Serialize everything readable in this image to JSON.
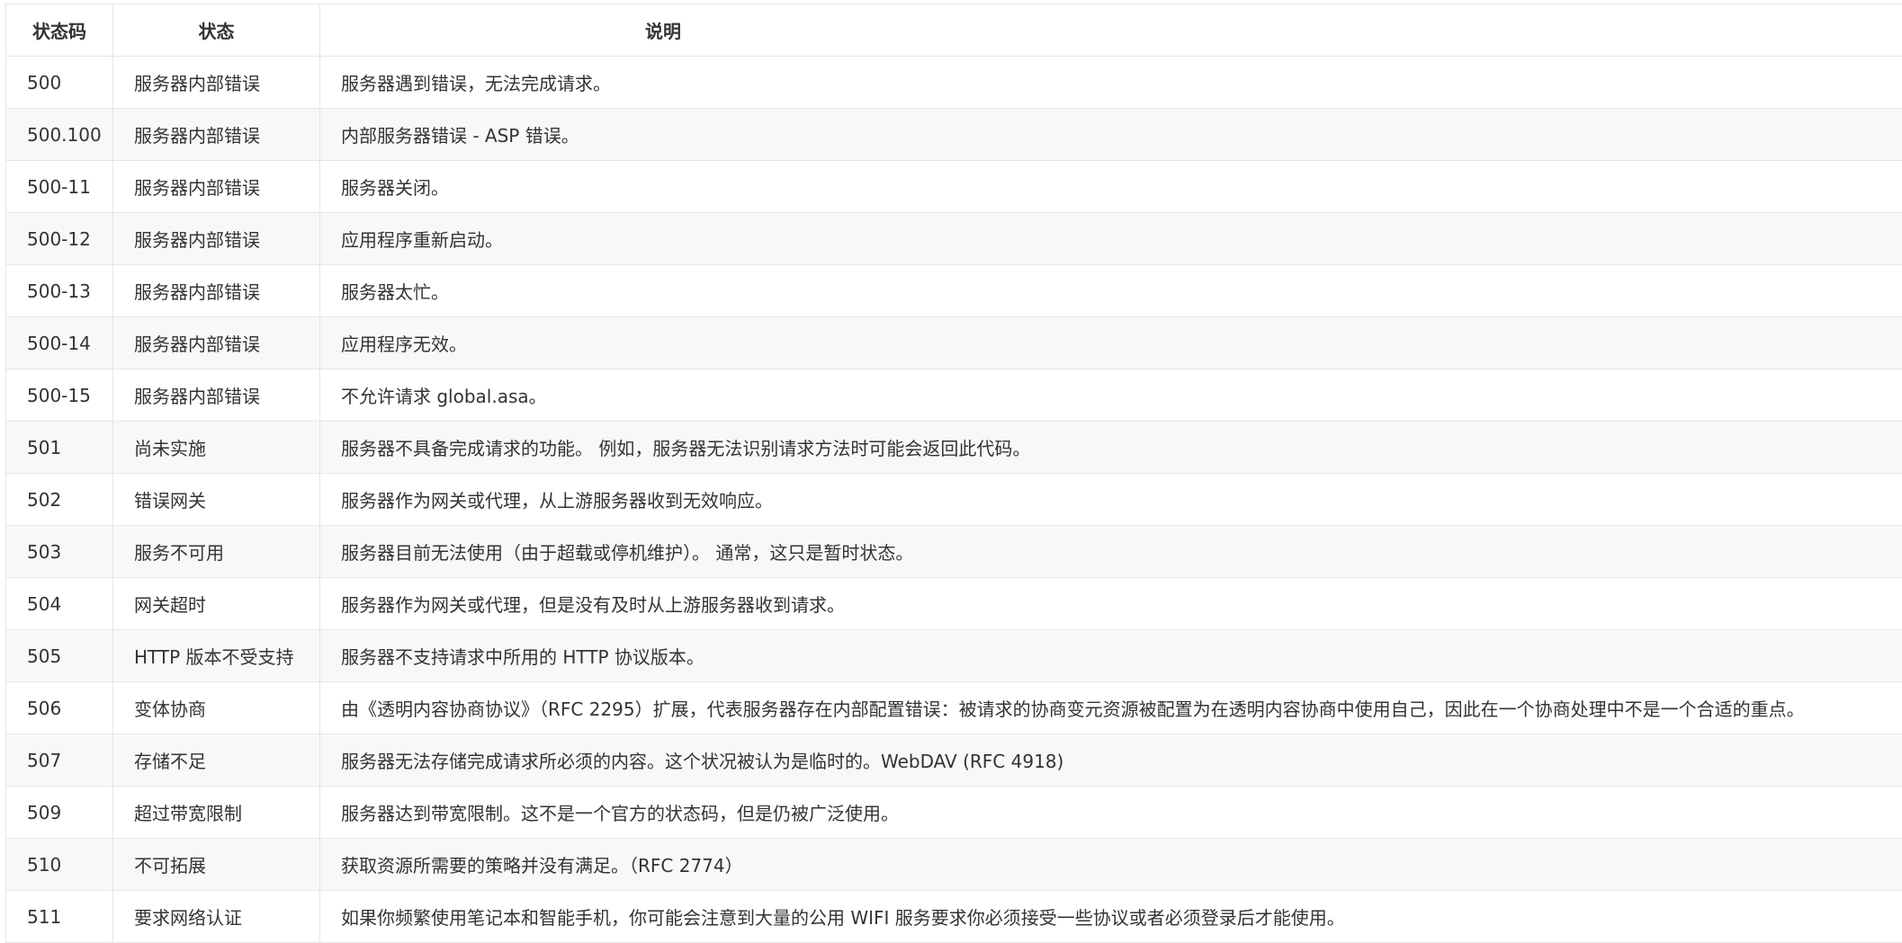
{
  "table": {
    "headers": {
      "code": "状态码",
      "status": "状态",
      "description": "说明"
    },
    "rows": [
      {
        "code": "500",
        "status": "服务器内部错误",
        "description": "服务器遇到错误，无法完成请求。"
      },
      {
        "code": "500.100",
        "status": "服务器内部错误",
        "description": "内部服务器错误 - ASP 错误。"
      },
      {
        "code": "500-11",
        "status": "服务器内部错误",
        "description": "服务器关闭。"
      },
      {
        "code": "500-12",
        "status": "服务器内部错误",
        "description": "应用程序重新启动。"
      },
      {
        "code": "500-13",
        "status": "服务器内部错误",
        "description": "服务器太忙。"
      },
      {
        "code": "500-14",
        "status": "服务器内部错误",
        "description": "应用程序无效。"
      },
      {
        "code": "500-15",
        "status": "服务器内部错误",
        "description": "不允许请求 global.asa。"
      },
      {
        "code": "501",
        "status": "尚未实施",
        "description": "服务器不具备完成请求的功能。 例如，服务器无法识别请求方法时可能会返回此代码。"
      },
      {
        "code": "502",
        "status": "错误网关",
        "description": "服务器作为网关或代理，从上游服务器收到无效响应。"
      },
      {
        "code": "503",
        "status": "服务不可用",
        "description": "服务器目前无法使用（由于超载或停机维护）。 通常，这只是暂时状态。"
      },
      {
        "code": "504",
        "status": "网关超时",
        "description": "服务器作为网关或代理，但是没有及时从上游服务器收到请求。"
      },
      {
        "code": "505",
        "status": "HTTP 版本不受支持",
        "description": "服务器不支持请求中所用的 HTTP 协议版本。"
      },
      {
        "code": "506",
        "status": "变体协商",
        "description": "由《透明内容协商协议》（RFC 2295）扩展，代表服务器存在内部配置错误：被请求的协商变元资源被配置为在透明内容协商中使用自己，因此在一个协商处理中不是一个合适的重点。"
      },
      {
        "code": "507",
        "status": "存储不足",
        "description": "服务器无法存储完成请求所必须的内容。这个状况被认为是临时的。WebDAV (RFC 4918)"
      },
      {
        "code": "509",
        "status": "超过带宽限制",
        "description": "服务器达到带宽限制。这不是一个官方的状态码，但是仍被广泛使用。"
      },
      {
        "code": "510",
        "status": "不可拓展",
        "description": "获取资源所需要的策略并没有满足。（RFC 2774）"
      },
      {
        "code": "511",
        "status": "要求网络认证",
        "description": "如果你频繁使用笔记本和智能手机，你可能会注意到大量的公用 WIFI 服务要求你必须接受一些协议或者必须登录后才能使用。"
      }
    ]
  }
}
